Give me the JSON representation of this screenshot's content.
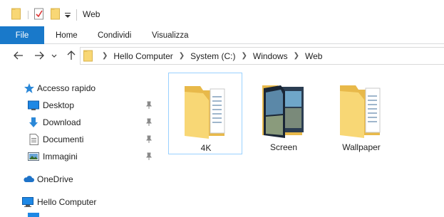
{
  "window": {
    "title": "Web"
  },
  "ribbon": {
    "tabs": [
      {
        "label": "File",
        "active": true
      },
      {
        "label": "Home"
      },
      {
        "label": "Condividi"
      },
      {
        "label": "Visualizza"
      }
    ]
  },
  "address": {
    "breadcrumbs": [
      "Hello Computer",
      "System (C:)",
      "Windows",
      "Web"
    ]
  },
  "navpane": {
    "quick_access": {
      "label": "Accesso rapido",
      "icon": "star-icon"
    },
    "items": [
      {
        "label": "Desktop",
        "icon": "desktop-icon",
        "pinned": true
      },
      {
        "label": "Download",
        "icon": "download-icon",
        "pinned": true
      },
      {
        "label": "Documenti",
        "icon": "documents-icon",
        "pinned": true
      },
      {
        "label": "Immagini",
        "icon": "pictures-icon",
        "pinned": true
      }
    ],
    "onedrive": {
      "label": "OneDrive",
      "icon": "cloud-icon"
    },
    "computer": {
      "label": "Hello Computer",
      "icon": "computer-icon"
    }
  },
  "content": {
    "folders": [
      {
        "label": "4K",
        "selected": true
      },
      {
        "label": "Screen",
        "selected": false
      },
      {
        "label": "Wallpaper",
        "selected": false
      }
    ]
  },
  "colors": {
    "accent": "#1979ca",
    "folder": "#f8d775",
    "selection_border": "#99d1ff"
  }
}
